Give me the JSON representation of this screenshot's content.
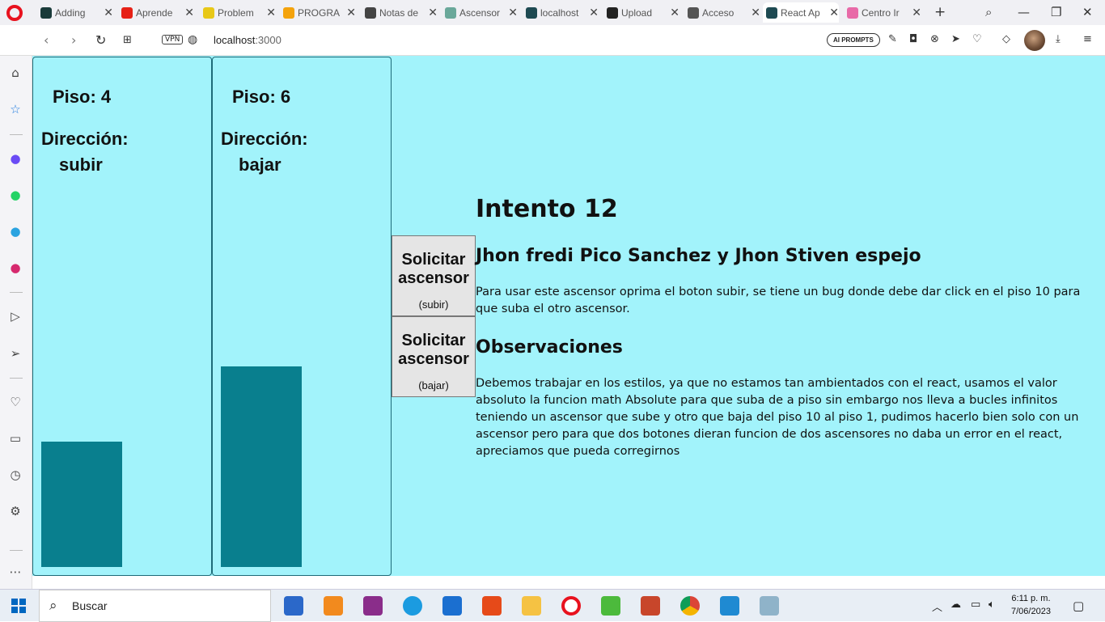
{
  "browser": {
    "tabs": [
      {
        "label": "Adding",
        "color": "#1a3b3a"
      },
      {
        "label": "Aprende",
        "color": "#e62117"
      },
      {
        "label": "Problem",
        "color": "#e8c817"
      },
      {
        "label": "PROGRA",
        "color": "#f4a30c"
      },
      {
        "label": "Notas de",
        "color": "#444444"
      },
      {
        "label": "Ascensor",
        "color": "#6aa89a"
      },
      {
        "label": "localhost",
        "color": "#1e4a52"
      },
      {
        "label": "Upload",
        "color": "#222222"
      },
      {
        "label": "Acceso",
        "color": "#555555"
      },
      {
        "label": "React Ap",
        "color": "#1e4a52"
      },
      {
        "label": "Centro Ir",
        "color": "#e86aa8"
      }
    ],
    "url_host": "localhost",
    "url_port": ":3000",
    "vpn": "VPN",
    "ai_prompts": "AI PROMPTS"
  },
  "app": {
    "elevators": [
      {
        "floor_label": "Piso: 4",
        "direction_title": "Dirección:",
        "direction": "subir",
        "level_fraction": 0.25
      },
      {
        "floor_label": "Piso: 6",
        "direction_title": "Dirección:",
        "direction": "bajar",
        "level_fraction": 0.4
      }
    ],
    "buttons": [
      {
        "main": "Solicitar ascensor",
        "sub": "(subir)"
      },
      {
        "main": "Solicitar ascensor",
        "sub": "(bajar)"
      }
    ],
    "title": "Intento 12",
    "authors": "Jhon fredi Pico Sanchez y Jhon Stiven espejo",
    "instructions": "Para usar este ascensor oprima el boton subir, se tiene un bug donde debe dar click en el piso 10 para que suba el otro ascensor.",
    "obs_title": "Observaciones",
    "obs_text": "Debemos trabajar en los estilos, ya que no estamos tan ambientados con el react, usamos el valor absoluto la funcion math Absolute para que suba de a piso sin embargo nos lleva a bucles infinitos teniendo un ascensor que sube y otro que baja del piso 10 al piso 1, pudimos hacerlo bien solo con un ascensor pero para que dos botones dieran funcion de dos ascensores no daba un error en el react, apreciamos que pueda corregirnos"
  },
  "taskbar": {
    "search": "Buscar",
    "time": "6:11 p. m.",
    "date": "7/06/2023"
  },
  "colors": {
    "page_bg": "#a2f3fb",
    "car": "#097f8e",
    "button_bg": "#e5e5e5"
  }
}
